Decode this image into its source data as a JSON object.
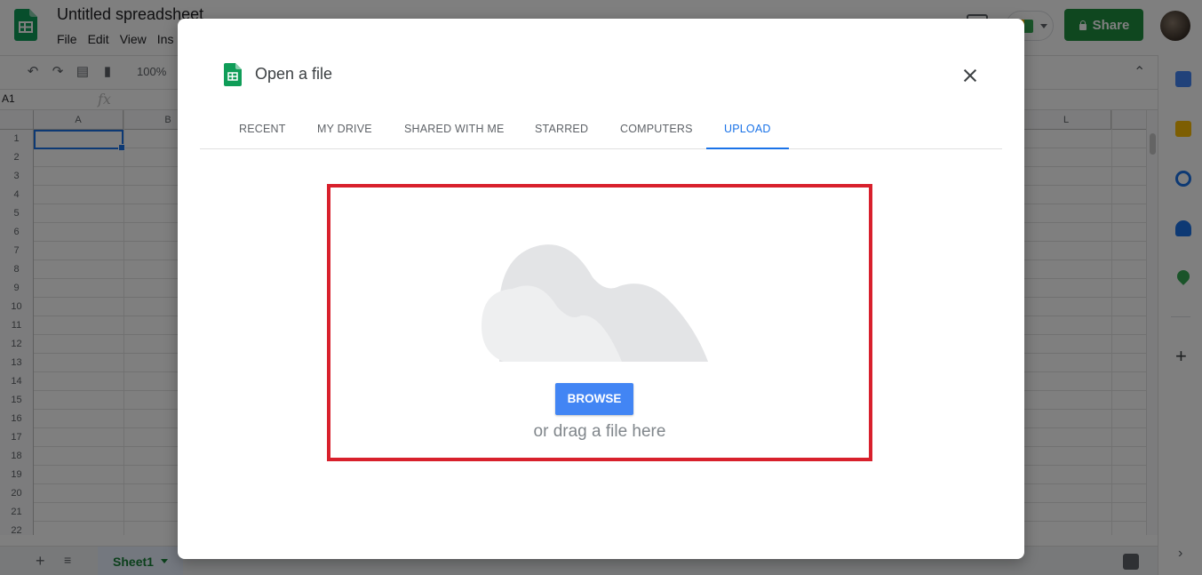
{
  "app": {
    "doc_title": "Untitled spreadsheet",
    "menus": [
      "File",
      "Edit",
      "View",
      "Ins"
    ],
    "share_label": "Share",
    "zoom": "100%",
    "name_box": "A1",
    "fx_label": "fx",
    "columns": [
      "A",
      "B",
      "L"
    ],
    "rows": [
      "1",
      "2",
      "3",
      "4",
      "5",
      "6",
      "7",
      "8",
      "9",
      "10",
      "11",
      "12",
      "13",
      "14",
      "15",
      "16",
      "17",
      "18",
      "19",
      "20",
      "21",
      "22"
    ],
    "sheet_tab": "Sheet1"
  },
  "dialog": {
    "title": "Open a file",
    "tabs": [
      {
        "label": "RECENT",
        "active": false
      },
      {
        "label": "MY DRIVE",
        "active": false
      },
      {
        "label": "SHARED WITH ME",
        "active": false
      },
      {
        "label": "STARRED",
        "active": false
      },
      {
        "label": "COMPUTERS",
        "active": false
      },
      {
        "label": "UPLOAD",
        "active": true
      }
    ],
    "browse_label": "BROWSE",
    "drag_text": "or drag a file here"
  },
  "colors": {
    "accent": "#1a73e8",
    "share_green": "#1e8e3e",
    "browse_blue": "#4285f4",
    "highlight_red": "#d8202c"
  },
  "icons": [
    "sheets-logo-icon",
    "close-icon",
    "cloud-upload-icon",
    "lock-icon",
    "undo-icon",
    "redo-icon",
    "print-icon",
    "paint-format-icon",
    "comment-icon",
    "meet-icon",
    "plus-icon",
    "chevron-up-icon",
    "chevron-right-icon",
    "calendar-icon",
    "keep-icon",
    "tasks-icon",
    "contacts-icon",
    "maps-icon"
  ]
}
